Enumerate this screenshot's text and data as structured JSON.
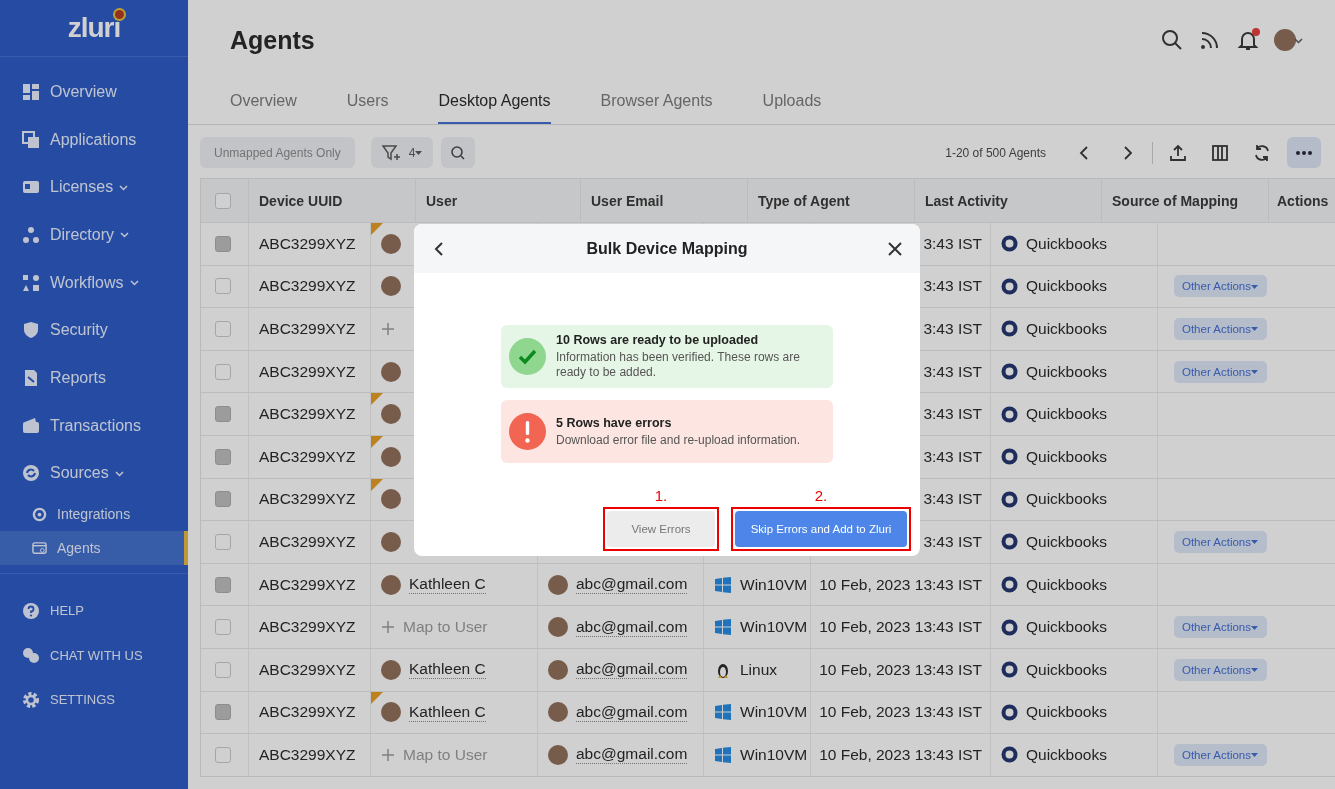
{
  "sidebar": {
    "logo": "zluri",
    "items": [
      {
        "label": "Overview",
        "expandable": false,
        "selected": false
      },
      {
        "label": "Applications",
        "expandable": false,
        "selected": false
      },
      {
        "label": "Licenses",
        "expandable": true,
        "selected": false
      },
      {
        "label": "Directory",
        "expandable": true,
        "selected": false
      },
      {
        "label": "Workflows",
        "expandable": true,
        "selected": false
      },
      {
        "label": "Security",
        "expandable": false,
        "selected": false
      },
      {
        "label": "Reports",
        "expandable": false,
        "selected": false
      },
      {
        "label": "Transactions",
        "expandable": false,
        "selected": false
      },
      {
        "label": "Sources",
        "expandable": true,
        "selected": false,
        "children": [
          {
            "label": "Integrations",
            "selected": false
          },
          {
            "label": "Agents",
            "selected": true
          }
        ]
      }
    ],
    "footer_items": [
      {
        "label": "HELP"
      },
      {
        "label": "CHAT WITH US"
      },
      {
        "label": "SETTINGS"
      }
    ]
  },
  "page": {
    "title": "Agents",
    "notification_dot": true
  },
  "tabs": [
    {
      "label": "Overview",
      "selected": false
    },
    {
      "label": "Users",
      "selected": false
    },
    {
      "label": "Desktop Agents",
      "selected": true
    },
    {
      "label": "Browser Agents",
      "selected": false
    },
    {
      "label": "Uploads",
      "selected": false
    }
  ],
  "toolbar": {
    "filter_button": "Unmapped Agents Only",
    "filter_count": "4",
    "pagination": "1-20 of 500 Agents"
  },
  "table": {
    "select_all_checked": false,
    "columns": [
      "Device UUID",
      "User",
      "User Email",
      "Type of Agent",
      "Last Activity",
      "Source of Mapping",
      "Actions"
    ],
    "rows": [
      {
        "uuid": "ABC3299XYZ",
        "user": {
          "kind": "person"
        },
        "last_activity": "3:43 IST",
        "source": "Quickbooks",
        "disabled": true,
        "flagged": true
      },
      {
        "uuid": "ABC3299XYZ",
        "user": {
          "kind": "person"
        },
        "last_activity": "3:43 IST",
        "source": "Quickbooks",
        "action": "Other Actions",
        "disabled": false,
        "flagged": false
      },
      {
        "uuid": "ABC3299XYZ",
        "user": {
          "kind": "map"
        },
        "last_activity": "3:43 IST",
        "source": "Quickbooks",
        "action": "Other Actions",
        "disabled": false,
        "flagged": false
      },
      {
        "uuid": "ABC3299XYZ",
        "user": {
          "kind": "person"
        },
        "last_activity": "3:43 IST",
        "source": "Quickbooks",
        "action": "Other Actions",
        "disabled": false,
        "flagged": false
      },
      {
        "uuid": "ABC3299XYZ",
        "user": {
          "kind": "person"
        },
        "last_activity": "3:43 IST",
        "source": "Quickbooks",
        "disabled": true,
        "flagged": true
      },
      {
        "uuid": "ABC3299XYZ",
        "user": {
          "kind": "person"
        },
        "last_activity": "3:43 IST",
        "source": "Quickbooks",
        "disabled": true,
        "flagged": true
      },
      {
        "uuid": "ABC3299XYZ",
        "user": {
          "kind": "person"
        },
        "last_activity": "3:43 IST",
        "source": "Quickbooks",
        "disabled": true,
        "flagged": true
      },
      {
        "uuid": "ABC3299XYZ",
        "user": {
          "kind": "person"
        },
        "last_activity": "3:43 IST",
        "source": "Quickbooks",
        "action": "Other Actions",
        "disabled": false,
        "flagged": false
      },
      {
        "uuid": "ABC3299XYZ",
        "user": {
          "kind": "person",
          "name": "Kathleen C"
        },
        "email": "abc@gmail.com",
        "agent": {
          "kind": "windows",
          "name": "Win10VM"
        },
        "last_activity": "10 Feb, 2023 13:43 IST",
        "source": "Quickbooks",
        "disabled": true,
        "flagged": false
      },
      {
        "uuid": "ABC3299XYZ",
        "user": {
          "kind": "map",
          "name": "Map to User"
        },
        "email": "abc@gmail.com",
        "agent": {
          "kind": "windows",
          "name": "Win10VM"
        },
        "last_activity": "10 Feb, 2023 13:43 IST",
        "source": "Quickbooks",
        "action": "Other Actions",
        "disabled": false,
        "flagged": false
      },
      {
        "uuid": "ABC3299XYZ",
        "user": {
          "kind": "person",
          "name": "Kathleen C"
        },
        "email": "abc@gmail.com",
        "agent": {
          "kind": "linux",
          "name": "Linux"
        },
        "last_activity": "10 Feb, 2023 13:43 IST",
        "source": "Quickbooks",
        "action": "Other Actions",
        "disabled": false,
        "flagged": false
      },
      {
        "uuid": "ABC3299XYZ",
        "user": {
          "kind": "person",
          "name": "Kathleen C"
        },
        "email": "abc@gmail.com",
        "agent": {
          "kind": "windows",
          "name": "Win10VM"
        },
        "last_activity": "10 Feb, 2023 13:43 IST",
        "source": "Quickbooks",
        "disabled": true,
        "flagged": true
      },
      {
        "uuid": "ABC3299XYZ",
        "user": {
          "kind": "map",
          "name": "Map to User"
        },
        "email": "abc@gmail.com",
        "agent": {
          "kind": "windows",
          "name": "Win10VM"
        },
        "last_activity": "10 Feb, 2023 13:43 IST",
        "source": "Quickbooks",
        "action": "Other Actions",
        "disabled": false,
        "flagged": false
      }
    ]
  },
  "modal": {
    "title": "Bulk Device Mapping",
    "statuses": [
      {
        "kind": "success",
        "title": "10 Rows are ready to be uploaded",
        "text": "Information has been verified. These rows are ready to be added."
      },
      {
        "kind": "error",
        "title": "5 Rows have errors",
        "text": "Download error file and re-upload information."
      }
    ],
    "buttons": [
      {
        "label": "View Errors",
        "kind": "secondary",
        "annotation": "1."
      },
      {
        "label": "Skip Errors and Add to Zluri",
        "kind": "primary",
        "annotation": "2."
      }
    ]
  }
}
